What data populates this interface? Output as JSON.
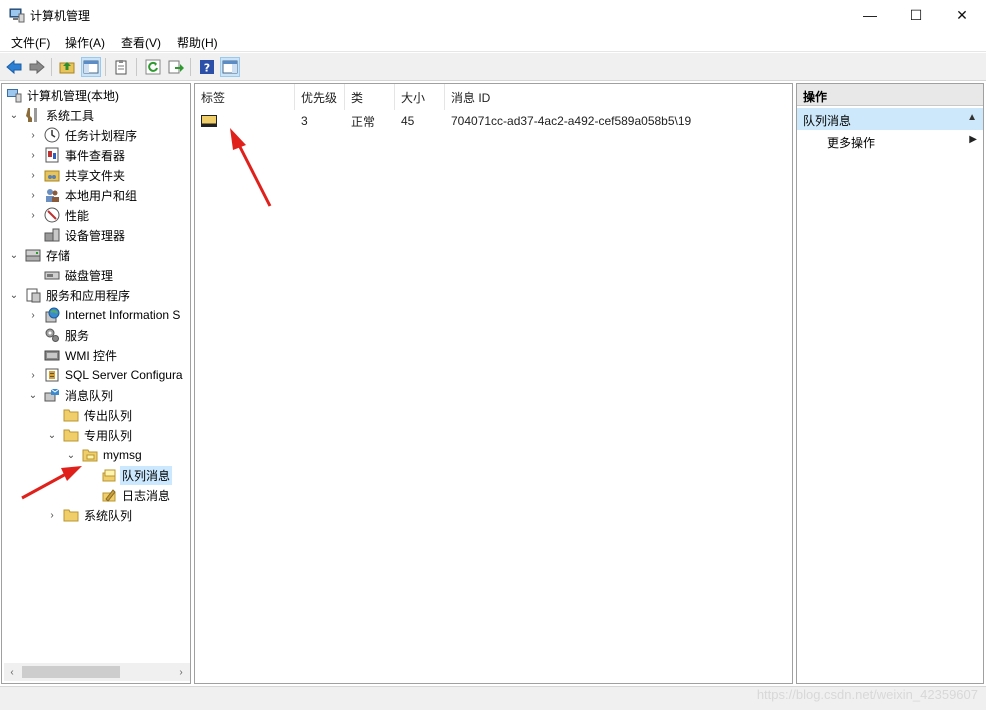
{
  "window": {
    "title": "计算机管理",
    "minimize": "—",
    "maximize": "☐",
    "close": "✕"
  },
  "menu": [
    "文件(F)",
    "操作(A)",
    "查看(V)",
    "帮助(H)"
  ],
  "tree": {
    "root": "计算机管理(本地)",
    "items": {
      "system_tools": "系统工具",
      "task_scheduler": "任务计划程序",
      "event_viewer": "事件查看器",
      "shared_folders": "共享文件夹",
      "local_users": "本地用户和组",
      "performance": "性能",
      "device_manager": "设备管理器",
      "storage": "存储",
      "disk_management": "磁盘管理",
      "services_apps": "服务和应用程序",
      "iis": "Internet Information S",
      "services": "服务",
      "wmi": "WMI 控件",
      "sql_server": "SQL Server Configura",
      "message_queuing": "消息队列",
      "outgoing_queues": "传出队列",
      "private_queues": "专用队列",
      "mymsg": "mymsg",
      "queue_messages": "队列消息",
      "journal_messages": "日志消息",
      "system_queues": "系统队列"
    }
  },
  "list": {
    "columns": [
      "标签",
      "优先级",
      "类",
      "大小",
      "消息 ID"
    ],
    "rows": [
      {
        "label": "",
        "priority": "3",
        "class": "正常",
        "size": "45",
        "id": "704071cc-ad37-4ac2-a492-cef589a058b5\\19"
      }
    ]
  },
  "actions": {
    "title": "操作",
    "section": "队列消息",
    "more": "更多操作"
  },
  "watermark": "https://blog.csdn.net/weixin_42359607",
  "colors": {
    "selection": "#cce8ff",
    "arrow": "#e0201a",
    "toolbar_bg": "#f0f0f0"
  }
}
